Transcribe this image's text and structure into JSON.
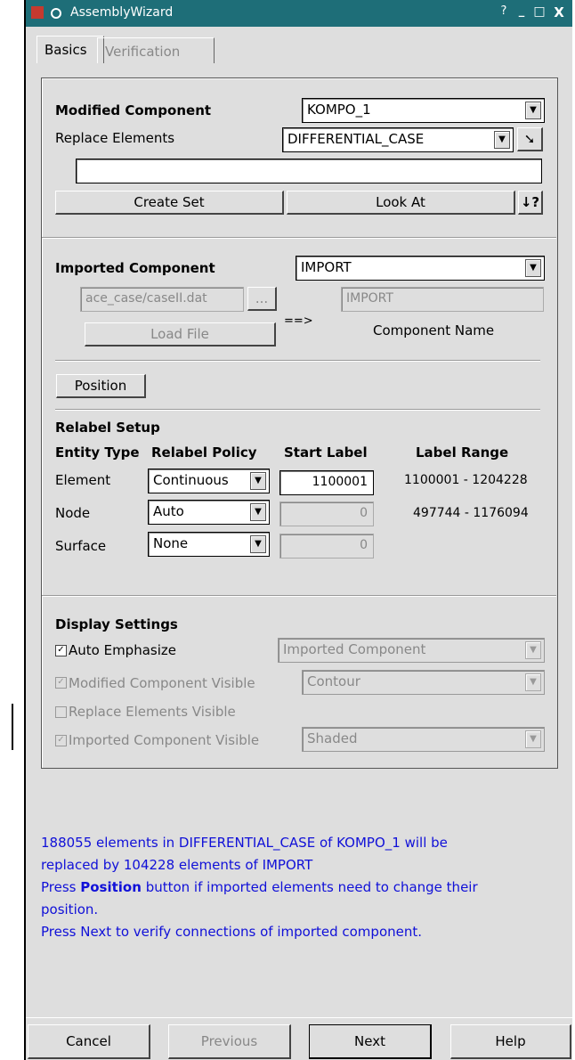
{
  "window": {
    "title": "AssemblyWizard",
    "controls": [
      "?",
      "_",
      "□",
      "X"
    ]
  },
  "tabs": [
    {
      "label": "Basics"
    },
    {
      "label": "Verification"
    }
  ],
  "modified": {
    "heading": "Modified Component",
    "component": "KOMPO_1",
    "replace_label": "Replace Elements",
    "replace_value": "DIFFERENTIAL_CASE",
    "set_field": "",
    "create_set": "Create Set",
    "look_at": "Look At",
    "help_glyph": "↓?"
  },
  "imported": {
    "heading": "Imported Component",
    "component": "IMPORT",
    "file": "ace_case/caseII.dat",
    "browse": "...",
    "name_field": "IMPORT",
    "load_file": "Load File",
    "arrow": "==>",
    "component_name_label": "Component Name",
    "position": "Position"
  },
  "relabel": {
    "heading": "Relabel Setup",
    "headers": [
      "Entity Type",
      "Relabel Policy",
      "Start Label",
      "Label Range"
    ],
    "rows": [
      {
        "entity": "Element",
        "policy": "Continuous",
        "start": "1100001",
        "range": "1100001 - 1204228"
      },
      {
        "entity": "Node",
        "policy": "Auto",
        "start": "0",
        "range": "497744 - 1176094"
      },
      {
        "entity": "Surface",
        "policy": "None",
        "start": "0",
        "range": ""
      }
    ]
  },
  "display": {
    "heading": "Display Settings",
    "auto_emphasize": {
      "label": "Auto Emphasize",
      "checked": true,
      "value": "Imported Component"
    },
    "modified_visible": {
      "label": "Modified Component Visible",
      "checked": true,
      "value": "Contour"
    },
    "replace_visible": {
      "label": "Replace Elements Visible",
      "checked": false
    },
    "imported_visible": {
      "label": "Imported Component Visible",
      "checked": true,
      "value": "Shaded"
    }
  },
  "messages": {
    "line1": "188055 elements in DIFFERENTIAL_CASE of KOMPO_1 will be",
    "line2": "replaced by 104228 elements of IMPORT",
    "line3_pre": "Press ",
    "line3_bold": "Position",
    "line3_post": " button if imported elements need to change their",
    "line4": "position.",
    "line5": "Press Next to verify connections of imported component."
  },
  "footer": {
    "cancel": "Cancel",
    "previous": "Previous",
    "next": "Next",
    "help": "Help"
  },
  "colors": {
    "titlebar": "#1e6e78",
    "message": "#1010d8",
    "background": "#dedede"
  }
}
